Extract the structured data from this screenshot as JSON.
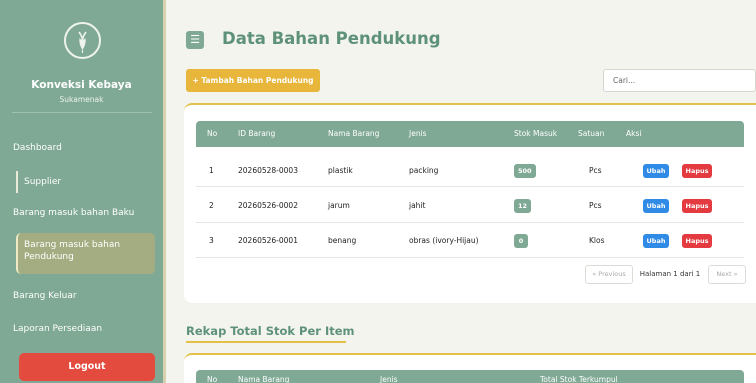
{
  "sidebar": {
    "brand_name": "Konveksi Kebaya",
    "brand_sub": "Sukamenak",
    "items": [
      {
        "label": "Dashboard"
      },
      {
        "label": "Supplier"
      },
      {
        "label": "Barang masuk bahan Baku"
      },
      {
        "label": "Barang masuk bahan Pendukung",
        "active": true
      },
      {
        "label": "Barang Keluar"
      },
      {
        "label": "Laporan Persediaan"
      }
    ],
    "logout_label": "Logout"
  },
  "header": {
    "menu_icon": "menu-icon",
    "title": "Data Bahan Pendukung"
  },
  "toolbar": {
    "add_label": "+ Tambah Bahan Pendukung",
    "search_placeholder": "Cari..."
  },
  "table": {
    "columns": [
      "No",
      "ID Barang",
      "Nama Barang",
      "Jenis",
      "Stok Masuk",
      "Satuan",
      "Aksi"
    ],
    "rows": [
      {
        "no": "1",
        "id": "20260528-0003",
        "nama": "plastik",
        "jenis": "packing",
        "stok": "500",
        "satuan": "Pcs"
      },
      {
        "no": "2",
        "id": "20260526-0002",
        "nama": "jarum",
        "jenis": "jahit",
        "stok": "12",
        "satuan": "Pcs"
      },
      {
        "no": "3",
        "id": "20260526-0001",
        "nama": "benang",
        "jenis": "obras (ivory-Hijau)",
        "stok": "0",
        "satuan": "Klos"
      }
    ],
    "edit_label": "Ubah",
    "delete_label": "Hapus"
  },
  "pagination": {
    "prev_label": "« Previous",
    "info": "Halaman 1 dari 1",
    "next_label": "Next »"
  },
  "rekap": {
    "title": "Rekap Total Stok Per Item",
    "columns": [
      "No",
      "Nama Barang",
      "Jenis",
      "Total Stok Terkumpul"
    ]
  },
  "colors": {
    "sidebar": "#7fa995",
    "accent_yellow": "#e7b63b",
    "edit_blue": "#2f8be6",
    "delete_red": "#e33b40",
    "logout_red": "#e34b3f",
    "title_green": "#5e9278"
  }
}
